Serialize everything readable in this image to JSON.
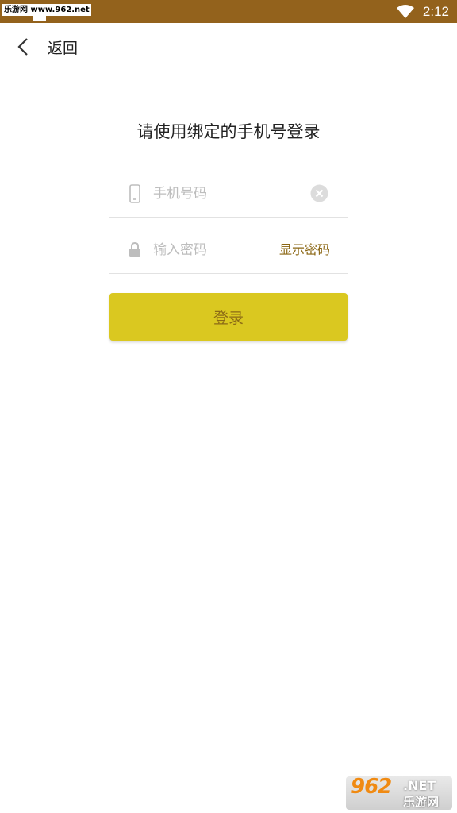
{
  "status_bar": {
    "watermark": "乐游网 www.962.net",
    "time": "2:12"
  },
  "header": {
    "back_label": "返回"
  },
  "title": "请使用绑定的手机号登录",
  "form": {
    "phone_placeholder": "手机号码",
    "password_placeholder": "输入密码",
    "show_password_label": "显示密码",
    "login_label": "登录"
  },
  "watermark": {
    "number": "962",
    "net": ".NET",
    "site": "乐游网"
  },
  "colors": {
    "status_bar": "#93621c",
    "button": "#dac820",
    "button_text": "#8b6a16",
    "link": "#8a6512"
  },
  "icons": {
    "back": "chevron-left-icon",
    "wifi": "wifi-icon",
    "phone": "phone-icon",
    "lock": "lock-icon",
    "clear": "clear-icon"
  }
}
